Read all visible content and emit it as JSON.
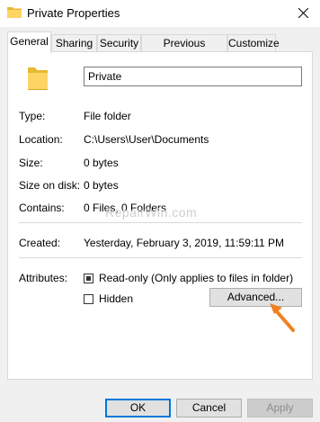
{
  "window": {
    "title": "Private Properties"
  },
  "tabs": [
    "General",
    "Sharing",
    "Security",
    "Previous Versions",
    "Customize"
  ],
  "name_field": {
    "value": "Private"
  },
  "info": [
    {
      "label": "Type:",
      "value": "File folder"
    },
    {
      "label": "Location:",
      "value": "C:\\Users\\User\\Documents"
    },
    {
      "label": "Size:",
      "value": "0 bytes"
    },
    {
      "label": "Size on disk:",
      "value": "0 bytes"
    },
    {
      "label": "Contains:",
      "value": "0 Files, 0 Folders"
    }
  ],
  "created": {
    "label": "Created:",
    "value": "Yesterday, February 3, 2019, 11:59:11 PM"
  },
  "attributes": {
    "label": "Attributes:",
    "readonly": {
      "label": "Read-only (Only applies to files in folder)",
      "checked": true,
      "indeterminate": true
    },
    "hidden": {
      "label": "Hidden",
      "checked": false
    },
    "advanced_button": "Advanced..."
  },
  "buttons": {
    "ok": "OK",
    "cancel": "Cancel",
    "apply": "Apply"
  },
  "watermark": "RepairWin.com",
  "colors": {
    "accent": "#0078d7",
    "folder": "#ffd466",
    "arrow": "#f08020"
  },
  "icons": {
    "title": "folder-icon",
    "close": "close-icon",
    "big": "folder-icon"
  }
}
